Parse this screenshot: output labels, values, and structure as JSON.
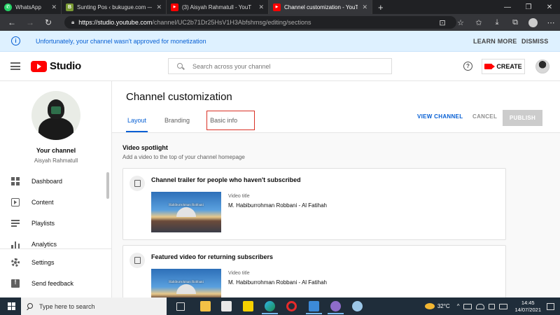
{
  "browser": {
    "tabs": [
      {
        "title": "WhatsApp",
        "fav_color": "#25d366",
        "fav_glyph": "✆",
        "active": false
      },
      {
        "title": "Sunting Pos ‹ bukugue.com — W",
        "fav_color": "#7a9a34",
        "fav_glyph": "B",
        "active": false
      },
      {
        "title": "(3) Aisyah Rahmatull - YouT",
        "fav_color": "#ff0000",
        "fav_glyph": "▶",
        "active": false
      },
      {
        "title": "Channel customization - YouTub",
        "fav_color": "#ff0000",
        "fav_glyph": "▶",
        "active": true
      }
    ],
    "url_host": "https://studio.youtube.com",
    "url_path": "/channel/UC2b71Dr25HsV1H3Abfshmsg/editing/sections"
  },
  "banner": {
    "message": "Unfortunately, your channel wasn't approved for monetization",
    "learn_more": "LEARN MORE",
    "dismiss": "DISMISS"
  },
  "header": {
    "logo_text": "Studio",
    "search_placeholder": "Search across your channel",
    "create_label": "CREATE"
  },
  "sidebar": {
    "channel_title": "Your channel",
    "channel_name": "Aisyah Rahmatull",
    "items": [
      {
        "label": "Dashboard"
      },
      {
        "label": "Content"
      },
      {
        "label": "Playlists"
      },
      {
        "label": "Analytics"
      },
      {
        "label": "Settings"
      },
      {
        "label": "Send feedback"
      }
    ]
  },
  "main": {
    "title": "Channel customization",
    "tabs": [
      {
        "label": "Layout",
        "active": true
      },
      {
        "label": "Branding",
        "active": false
      },
      {
        "label": "Basic info",
        "active": false,
        "highlighted": true
      }
    ],
    "view_channel": "VIEW CHANNEL",
    "cancel": "CANCEL",
    "publish": "PUBLISH",
    "section": {
      "title": "Video spotlight",
      "description": "Add a video to the top of your channel homepage"
    },
    "cards": [
      {
        "title": "Channel trailer for people who haven't subscribed",
        "video_label": "Video title",
        "video_name": "M. Habiburrohman Robbani - Al Fatihah",
        "thumb_text": "Habiburrohman Robbani"
      },
      {
        "title": "Featured video for returning subscribers",
        "video_label": "Video title",
        "video_name": "M. Habiburrohman Robbani - Al Fatihah",
        "thumb_text": "Habiburrohman Robbani"
      }
    ]
  },
  "taskbar": {
    "search_placeholder": "Type here to search",
    "temperature": "32°C",
    "time": "14:45",
    "date": "14/07/2021"
  }
}
